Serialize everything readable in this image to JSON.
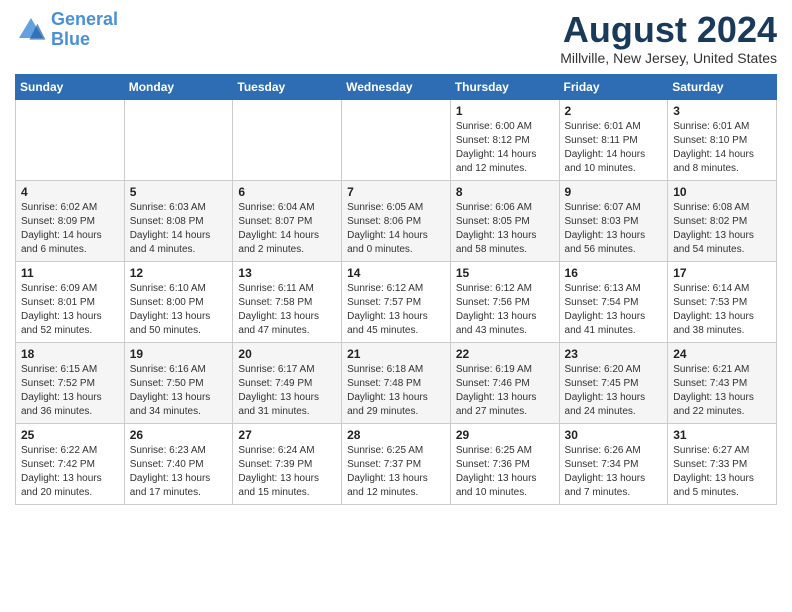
{
  "header": {
    "logo_line1": "General",
    "logo_line2": "Blue",
    "month": "August 2024",
    "location": "Millville, New Jersey, United States"
  },
  "weekdays": [
    "Sunday",
    "Monday",
    "Tuesday",
    "Wednesday",
    "Thursday",
    "Friday",
    "Saturday"
  ],
  "weeks": [
    [
      {
        "day": "",
        "info": ""
      },
      {
        "day": "",
        "info": ""
      },
      {
        "day": "",
        "info": ""
      },
      {
        "day": "",
        "info": ""
      },
      {
        "day": "1",
        "info": "Sunrise: 6:00 AM\nSunset: 8:12 PM\nDaylight: 14 hours\nand 12 minutes."
      },
      {
        "day": "2",
        "info": "Sunrise: 6:01 AM\nSunset: 8:11 PM\nDaylight: 14 hours\nand 10 minutes."
      },
      {
        "day": "3",
        "info": "Sunrise: 6:01 AM\nSunset: 8:10 PM\nDaylight: 14 hours\nand 8 minutes."
      }
    ],
    [
      {
        "day": "4",
        "info": "Sunrise: 6:02 AM\nSunset: 8:09 PM\nDaylight: 14 hours\nand 6 minutes."
      },
      {
        "day": "5",
        "info": "Sunrise: 6:03 AM\nSunset: 8:08 PM\nDaylight: 14 hours\nand 4 minutes."
      },
      {
        "day": "6",
        "info": "Sunrise: 6:04 AM\nSunset: 8:07 PM\nDaylight: 14 hours\nand 2 minutes."
      },
      {
        "day": "7",
        "info": "Sunrise: 6:05 AM\nSunset: 8:06 PM\nDaylight: 14 hours\nand 0 minutes."
      },
      {
        "day": "8",
        "info": "Sunrise: 6:06 AM\nSunset: 8:05 PM\nDaylight: 13 hours\nand 58 minutes."
      },
      {
        "day": "9",
        "info": "Sunrise: 6:07 AM\nSunset: 8:03 PM\nDaylight: 13 hours\nand 56 minutes."
      },
      {
        "day": "10",
        "info": "Sunrise: 6:08 AM\nSunset: 8:02 PM\nDaylight: 13 hours\nand 54 minutes."
      }
    ],
    [
      {
        "day": "11",
        "info": "Sunrise: 6:09 AM\nSunset: 8:01 PM\nDaylight: 13 hours\nand 52 minutes."
      },
      {
        "day": "12",
        "info": "Sunrise: 6:10 AM\nSunset: 8:00 PM\nDaylight: 13 hours\nand 50 minutes."
      },
      {
        "day": "13",
        "info": "Sunrise: 6:11 AM\nSunset: 7:58 PM\nDaylight: 13 hours\nand 47 minutes."
      },
      {
        "day": "14",
        "info": "Sunrise: 6:12 AM\nSunset: 7:57 PM\nDaylight: 13 hours\nand 45 minutes."
      },
      {
        "day": "15",
        "info": "Sunrise: 6:12 AM\nSunset: 7:56 PM\nDaylight: 13 hours\nand 43 minutes."
      },
      {
        "day": "16",
        "info": "Sunrise: 6:13 AM\nSunset: 7:54 PM\nDaylight: 13 hours\nand 41 minutes."
      },
      {
        "day": "17",
        "info": "Sunrise: 6:14 AM\nSunset: 7:53 PM\nDaylight: 13 hours\nand 38 minutes."
      }
    ],
    [
      {
        "day": "18",
        "info": "Sunrise: 6:15 AM\nSunset: 7:52 PM\nDaylight: 13 hours\nand 36 minutes."
      },
      {
        "day": "19",
        "info": "Sunrise: 6:16 AM\nSunset: 7:50 PM\nDaylight: 13 hours\nand 34 minutes."
      },
      {
        "day": "20",
        "info": "Sunrise: 6:17 AM\nSunset: 7:49 PM\nDaylight: 13 hours\nand 31 minutes."
      },
      {
        "day": "21",
        "info": "Sunrise: 6:18 AM\nSunset: 7:48 PM\nDaylight: 13 hours\nand 29 minutes."
      },
      {
        "day": "22",
        "info": "Sunrise: 6:19 AM\nSunset: 7:46 PM\nDaylight: 13 hours\nand 27 minutes."
      },
      {
        "day": "23",
        "info": "Sunrise: 6:20 AM\nSunset: 7:45 PM\nDaylight: 13 hours\nand 24 minutes."
      },
      {
        "day": "24",
        "info": "Sunrise: 6:21 AM\nSunset: 7:43 PM\nDaylight: 13 hours\nand 22 minutes."
      }
    ],
    [
      {
        "day": "25",
        "info": "Sunrise: 6:22 AM\nSunset: 7:42 PM\nDaylight: 13 hours\nand 20 minutes."
      },
      {
        "day": "26",
        "info": "Sunrise: 6:23 AM\nSunset: 7:40 PM\nDaylight: 13 hours\nand 17 minutes."
      },
      {
        "day": "27",
        "info": "Sunrise: 6:24 AM\nSunset: 7:39 PM\nDaylight: 13 hours\nand 15 minutes."
      },
      {
        "day": "28",
        "info": "Sunrise: 6:25 AM\nSunset: 7:37 PM\nDaylight: 13 hours\nand 12 minutes."
      },
      {
        "day": "29",
        "info": "Sunrise: 6:25 AM\nSunset: 7:36 PM\nDaylight: 13 hours\nand 10 minutes."
      },
      {
        "day": "30",
        "info": "Sunrise: 6:26 AM\nSunset: 7:34 PM\nDaylight: 13 hours\nand 7 minutes."
      },
      {
        "day": "31",
        "info": "Sunrise: 6:27 AM\nSunset: 7:33 PM\nDaylight: 13 hours\nand 5 minutes."
      }
    ]
  ]
}
